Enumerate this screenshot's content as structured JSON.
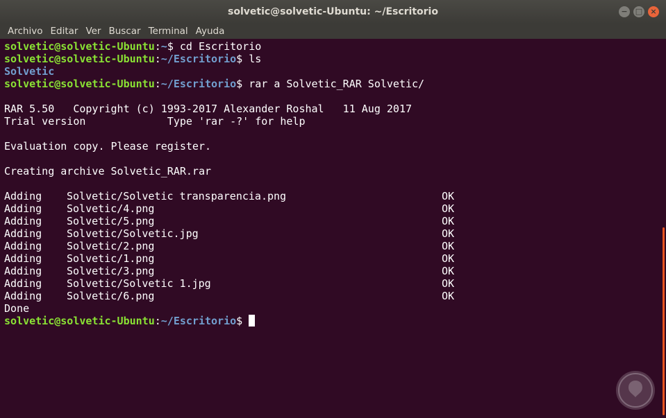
{
  "window": {
    "title": "solvetic@solvetic-Ubuntu: ~/Escritorio",
    "buttons": {
      "minimize": "−",
      "maximize": "□",
      "close": "×"
    }
  },
  "menu": [
    "Archivo",
    "Editar",
    "Ver",
    "Buscar",
    "Terminal",
    "Ayuda"
  ],
  "terminal": {
    "user_host": "solvetic@solvetic-Ubuntu",
    "cmd1": {
      "path": "~",
      "command": "cd Escritorio"
    },
    "cmd2": {
      "path": "~/Escritorio",
      "command": "ls"
    },
    "ls_output": "Solvetic",
    "cmd3": {
      "path": "~/Escritorio",
      "command": "rar a Solvetic_RAR Solvetic/"
    },
    "rar_header_1": "RAR 5.50   Copyright (c) 1993-2017 Alexander Roshal   11 Aug 2017",
    "rar_header_2": "Trial version             Type 'rar -?' for help",
    "evaluation": "Evaluation copy. Please register.",
    "creating": "Creating archive Solvetic_RAR.rar",
    "adding": [
      {
        "action": "Adding",
        "file": "Solvetic/Solvetic transparencia.png",
        "status": "OK"
      },
      {
        "action": "Adding",
        "file": "Solvetic/4.png",
        "status": "OK"
      },
      {
        "action": "Adding",
        "file": "Solvetic/5.png",
        "status": "OK"
      },
      {
        "action": "Adding",
        "file": "Solvetic/Solvetic.jpg",
        "status": "OK"
      },
      {
        "action": "Adding",
        "file": "Solvetic/2.png",
        "status": "OK"
      },
      {
        "action": "Adding",
        "file": "Solvetic/1.png",
        "status": "OK"
      },
      {
        "action": "Adding",
        "file": "Solvetic/3.png",
        "status": "OK"
      },
      {
        "action": "Adding",
        "file": "Solvetic/Solvetic 1.jpg",
        "status": "OK"
      },
      {
        "action": "Adding",
        "file": "Solvetic/6.png",
        "status": "OK"
      }
    ],
    "done": "Done",
    "final_prompt_path": "~/Escritorio"
  },
  "colors": {
    "background": "#300a24",
    "user": "#8ae234",
    "path": "#729fcf",
    "scrollbar": "#e95420"
  },
  "icons": {
    "watermark": "solvetic-logo-icon"
  }
}
